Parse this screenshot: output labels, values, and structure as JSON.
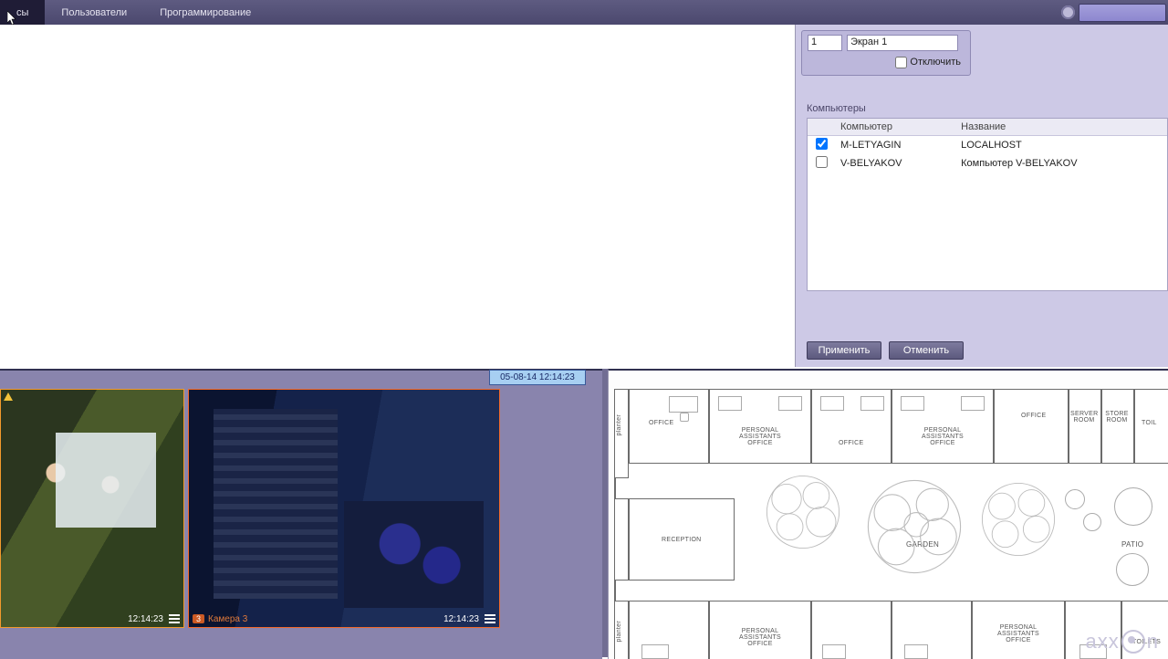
{
  "menu": {
    "item_active_suffix": "сы",
    "item_users": "Пользователи",
    "item_programming": "Программирование"
  },
  "screen": {
    "number": "1",
    "name": "Экран 1",
    "disable_label": "Отключить"
  },
  "computers": {
    "caption": "Компьютеры",
    "col_computer": "Компьютер",
    "col_name": "Название",
    "rows": [
      {
        "checked": true,
        "computer": "M-LETYAGIN",
        "name": "LOCALHOST"
      },
      {
        "checked": false,
        "computer": "V-BELYAKOV",
        "name": "Компьютер V-BELYAKOV"
      }
    ]
  },
  "buttons": {
    "apply": "Применить",
    "cancel": "Отменить"
  },
  "datetime": "05-08-14   12:14:23",
  "cameras": {
    "cam1_time": "12:14:23",
    "cam2_badge": "3",
    "cam2_label": "Камера 3",
    "cam2_time": "12:14:23"
  },
  "floorplan": {
    "planter": "planter",
    "office": "OFFICE",
    "pa_office": "PERSONAL ASSISTANTS\nOFFICE",
    "reception": "RECEPTION",
    "garden": "GARDEN",
    "server": "SERVER\nROOM",
    "store": "STORE\nROOM",
    "toilets_top": "TOIL",
    "toilets": "TOILETS",
    "patio": "PATIO"
  },
  "brand": "axxon"
}
